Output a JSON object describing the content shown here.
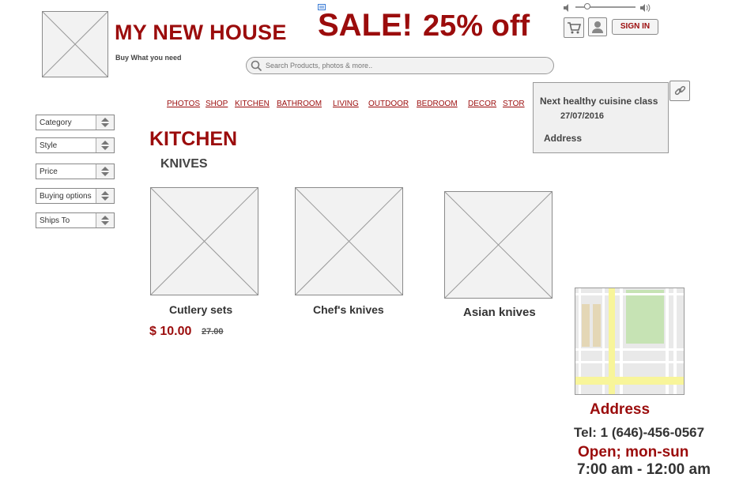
{
  "header": {
    "brand": "MY NEW HOUSE",
    "tagline": "Buy What you need",
    "sale_word": "SALE!",
    "sale_offer": "25% off",
    "signin_label": "SIGN IN",
    "volume_level": 0.2
  },
  "search": {
    "placeholder": "Search Products, photos & more.."
  },
  "nav": {
    "items": [
      "PHOTOS",
      "SHOP",
      "KITCHEN",
      "BATHROOM",
      "LIVING",
      "OUTDOOR",
      "BEDROOM",
      "DECOR",
      "STOR"
    ]
  },
  "filters": {
    "items": [
      "Category",
      "Style",
      "Price",
      "Buying options",
      "Ships To"
    ]
  },
  "event": {
    "title": "Next healthy cuisine class",
    "date": "27/07/2016",
    "address": "Address"
  },
  "main": {
    "heading": "KITCHEN",
    "subheading": "KNIVES",
    "products": [
      {
        "name": "Cutlery sets",
        "price": "$ 10.00",
        "old_price": "27.00"
      },
      {
        "name": "Chef's knives"
      },
      {
        "name": "Asian knives"
      }
    ]
  },
  "contact": {
    "title": "Address",
    "tel": "Tel: 1 (646)-456-0567",
    "open": "Open; mon-sun",
    "hours": "7:00 am - 12:00 am"
  },
  "colors": {
    "accent": "#9b0c0c",
    "placeholder": "#f2f2f2",
    "map_green": "#c6e3b4",
    "map_yellow": "#f8f59a"
  }
}
